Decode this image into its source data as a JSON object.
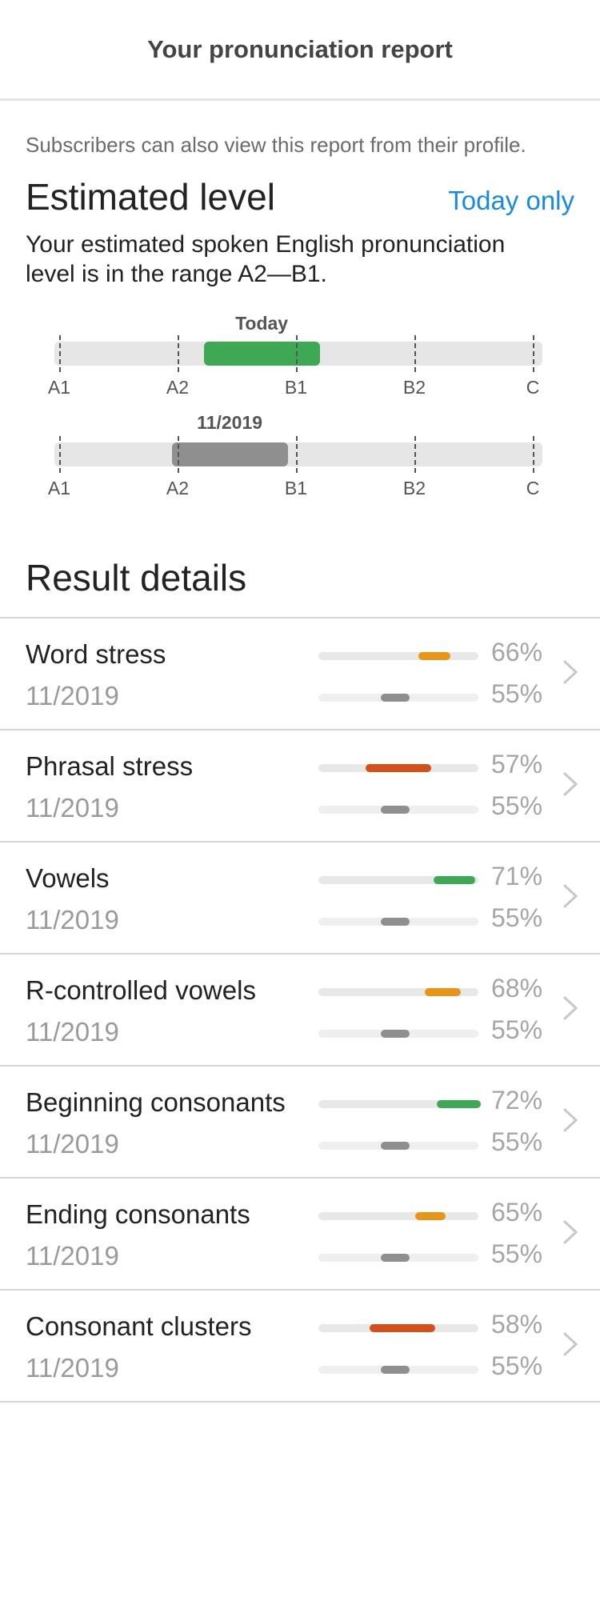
{
  "header": {
    "title": "Your pronunciation report"
  },
  "note": "Subscribers can also view this report from their profile.",
  "estimated": {
    "title": "Estimated level",
    "link": "Today only",
    "description": "Your estimated spoken English pronunciation level is in the range A2—B1."
  },
  "scale_ticks": [
    "A1",
    "A2",
    "B1",
    "B2",
    "C"
  ],
  "scales": [
    {
      "label": "Today",
      "start_level": 1.22,
      "end_level": 2.2,
      "color": "#3ea855"
    },
    {
      "label": "11/2019",
      "start_level": 0.95,
      "end_level": 1.93,
      "color": "#8f8f8f"
    }
  ],
  "results": {
    "title": "Result details",
    "rows": [
      {
        "name": "Word stress",
        "date": "11/2019",
        "current_pct": "66%",
        "previous_pct": "55%",
        "current_value": 66,
        "previous_value": 55,
        "current_color": "#e8951a"
      },
      {
        "name": "Phrasal stress",
        "date": "11/2019",
        "current_pct": "57%",
        "previous_pct": "55%",
        "current_value": 57,
        "previous_value": 55,
        "current_color": "#d4501a"
      },
      {
        "name": "Vowels",
        "date": "11/2019",
        "current_pct": "71%",
        "previous_pct": "55%",
        "current_value": 71,
        "previous_value": 55,
        "current_color": "#3ea855"
      },
      {
        "name": "R-controlled vowels",
        "date": "11/2019",
        "current_pct": "68%",
        "previous_pct": "55%",
        "current_value": 68,
        "previous_value": 55,
        "current_color": "#e8951a"
      },
      {
        "name": "Beginning consonants",
        "date": "11/2019",
        "current_pct": "72%",
        "previous_pct": "55%",
        "current_value": 72,
        "previous_value": 55,
        "current_color": "#3ea855"
      },
      {
        "name": "Ending consonants",
        "date": "11/2019",
        "current_pct": "65%",
        "previous_pct": "55%",
        "current_value": 65,
        "previous_value": 55,
        "current_color": "#e8951a"
      },
      {
        "name": "Consonant clusters",
        "date": "11/2019",
        "current_pct": "58%",
        "previous_pct": "55%",
        "current_value": 58,
        "previous_value": 55,
        "current_color": "#d4501a"
      }
    ]
  },
  "colors": {
    "previous": "#8f8f8f",
    "chevron": "#c8c8c8"
  }
}
